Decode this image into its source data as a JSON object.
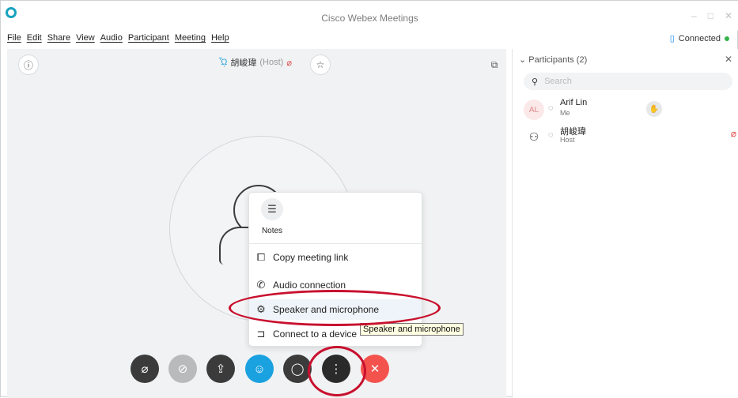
{
  "window": {
    "title": "Cisco Webex Meetings",
    "minimize": "–",
    "maximize": "□",
    "close": "✕"
  },
  "menu": [
    "File",
    "Edit",
    "Share",
    "View",
    "Audio",
    "Participant",
    "Meeting",
    "Help"
  ],
  "connection": {
    "icon": "signal-icon",
    "label": "Connected"
  },
  "stage": {
    "host_name": "胡峻瑋",
    "host_tag": "(Host)"
  },
  "popup": {
    "notes_label": "Notes",
    "items": [
      {
        "label": "Copy meeting link",
        "icon": "copy-icon"
      },
      {
        "label": "Audio connection",
        "icon": "phone-icon"
      },
      {
        "label": "Speaker and microphone",
        "icon": "gear-icon"
      },
      {
        "label": "Connect to a device",
        "icon": "cast-icon"
      }
    ]
  },
  "tooltip": "Speaker and microphone",
  "participants": {
    "header": "Participants (2)",
    "search_placeholder": "Search",
    "list": [
      {
        "initials": "AL",
        "name": "Arif Lin",
        "role": "Me"
      },
      {
        "initials": "",
        "name": "胡峻瑋",
        "role": "Host"
      }
    ]
  },
  "colors": {
    "accent": "#18a3c0",
    "participants_blue": "#1aa1e0",
    "leave_red": "#f4524d",
    "control_dark": "#3b3b3b",
    "annotation_red": "#c8102e"
  }
}
